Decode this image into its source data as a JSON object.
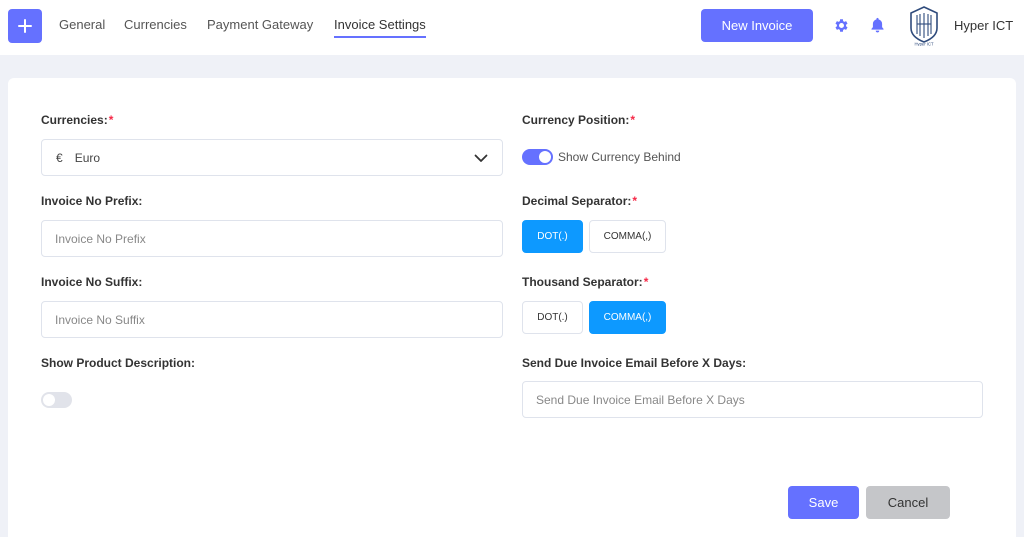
{
  "header": {
    "nav": [
      {
        "label": "General"
      },
      {
        "label": "Currencies"
      },
      {
        "label": "Payment Gateway"
      },
      {
        "label": "Invoice Settings",
        "active": true
      }
    ],
    "new_invoice_label": "New Invoice",
    "user_name": "Hyper ICT",
    "logo_caption": "Hyper ICT",
    "accent_color": "#6571ff"
  },
  "form": {
    "currencies": {
      "label": "Currencies:",
      "required": "*",
      "symbol": "€",
      "value": "Euro"
    },
    "invoice_prefix": {
      "label": "Invoice No Prefix:",
      "placeholder": "Invoice No Prefix",
      "value": ""
    },
    "invoice_suffix": {
      "label": "Invoice No Suffix:",
      "placeholder": "Invoice No Suffix",
      "value": ""
    },
    "show_product_description": {
      "label": "Show Product Description:",
      "enabled": false
    },
    "currency_position": {
      "label": "Currency Position:",
      "required": "*",
      "toggle_label": "Show Currency Behind",
      "enabled": true
    },
    "decimal_separator": {
      "label": "Decimal Separator:",
      "required": "*",
      "options": [
        "DOT(.)",
        "COMMA(,)"
      ],
      "selected": "DOT(.)"
    },
    "thousand_separator": {
      "label": "Thousand Separator:",
      "required": "*",
      "options": [
        "DOT(.)",
        "COMMA(,)"
      ],
      "selected": "COMMA(,)"
    },
    "due_email": {
      "label": "Send Due Invoice Email Before X Days:",
      "placeholder": "Send Due Invoice Email Before X Days",
      "value": ""
    }
  },
  "actions": {
    "save_label": "Save",
    "cancel_label": "Cancel"
  },
  "colors": {
    "selected_option": "#0d99ff",
    "required_mark": "#f62947"
  }
}
